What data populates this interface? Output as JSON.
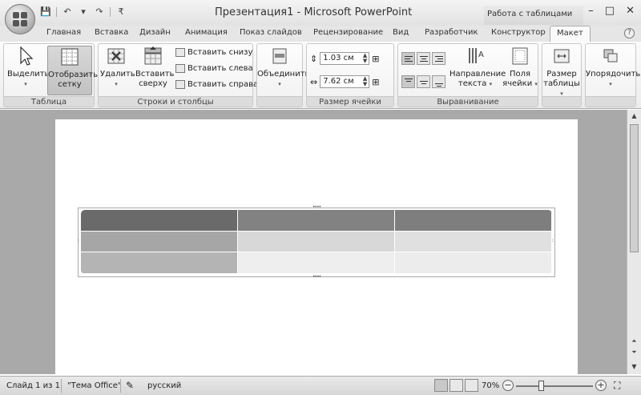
{
  "window": {
    "title": "Презентация1 - Microsoft PowerPoint",
    "context_title": "Работа с таблицами",
    "minimize": "–",
    "maximize": "□",
    "close": "✕"
  },
  "qat": {
    "save": "💾",
    "undo": "↶",
    "undo_drop": "▾",
    "redo": "↷",
    "customize": "₹"
  },
  "tabs": [
    "Главная",
    "Вставка",
    "Дизайн",
    "Анимация",
    "Показ слайдов",
    "Рецензирование",
    "Вид",
    "Разработчик",
    "Конструктор",
    "Макет"
  ],
  "active_tab": "Макет",
  "ribbon": {
    "groups": {
      "table": "Таблица",
      "rows_cols": "Строки и столбцы",
      "merge": "",
      "cell_size": "Размер ячейки",
      "alignment": "Выравнивание",
      "table_size": "",
      "arrange": ""
    },
    "select": "Выделить",
    "show_grid_1": "Отобразить",
    "show_grid_2": "сетку",
    "delete": "Удалить",
    "insert_above_1": "Вставить",
    "insert_above_2": "сверху",
    "insert_below": "Вставить снизу",
    "insert_left": "Вставить слева",
    "insert_right": "Вставить справа",
    "merge": "Объединить",
    "height_value": "1.03 см",
    "width_value": "7.62 см",
    "text_direction_1": "Направление",
    "text_direction_2": "текста",
    "cell_margins_1": "Поля",
    "cell_margins_2": "ячейки",
    "table_size_1": "Размер",
    "table_size_2": "таблицы",
    "arrange": "Упорядочить",
    "dropdown": "▾"
  },
  "statusbar": {
    "slide": "Слайд 1 из 1",
    "theme": "\"Тема Office\"",
    "language": "русский",
    "zoom": "70%",
    "zoom_minus": "−",
    "zoom_plus": "+"
  },
  "colors": {
    "header_cells": [
      "#6a6a6a",
      "#828282",
      "#7e7e7e"
    ],
    "slide_bg": "#ffffff",
    "workspace_bg": "#a9a9a9"
  }
}
